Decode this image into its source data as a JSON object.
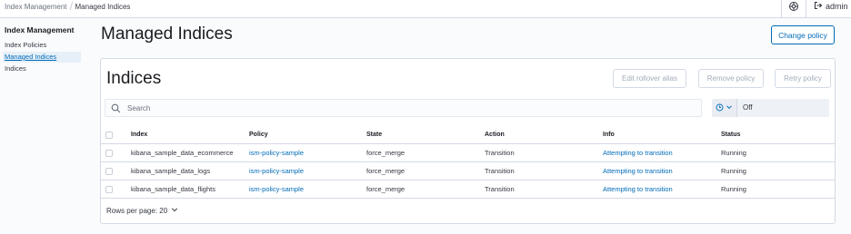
{
  "breadcrumbs": [
    "Index Management",
    "Managed Indices"
  ],
  "header": {
    "user_label": "admin",
    "help_icon": "help-icon",
    "logout_icon": "logout-icon"
  },
  "sidebar": {
    "title": "Index Management",
    "items": [
      {
        "label": "Index Policies",
        "active": false
      },
      {
        "label": "Managed Indices",
        "active": true
      },
      {
        "label": "Indices",
        "active": false
      }
    ]
  },
  "page": {
    "title": "Managed Indices",
    "change_policy_label": "Change policy"
  },
  "panel": {
    "title": "Indices",
    "edit_rollover_label": "Edit rollover alias",
    "remove_policy_label": "Remove policy",
    "retry_policy_label": "Retry policy",
    "search_placeholder": "Search",
    "refresh_value": "Off"
  },
  "table": {
    "columns": [
      "Index",
      "Policy",
      "State",
      "Action",
      "Info",
      "Status"
    ],
    "rows": [
      {
        "index": "kibana_sample_data_ecommerce",
        "policy": "ism-policy-sample",
        "state": "force_merge",
        "action": "Transition",
        "info": "Attempting to transition",
        "status": "Running"
      },
      {
        "index": "kibana_sample_data_logs",
        "policy": "ism-policy-sample",
        "state": "force_merge",
        "action": "Transition",
        "info": "Attempting to transition",
        "status": "Running"
      },
      {
        "index": "kibana_sample_data_flights",
        "policy": "ism-policy-sample",
        "state": "force_merge",
        "action": "Transition",
        "info": "Attempting to transition",
        "status": "Running"
      }
    ]
  },
  "pager": {
    "label": "Rows per page: 20"
  },
  "colors": {
    "accent": "#006bb8",
    "border": "#d3dae6",
    "text": "#343741",
    "disabled": "#a2abba"
  }
}
